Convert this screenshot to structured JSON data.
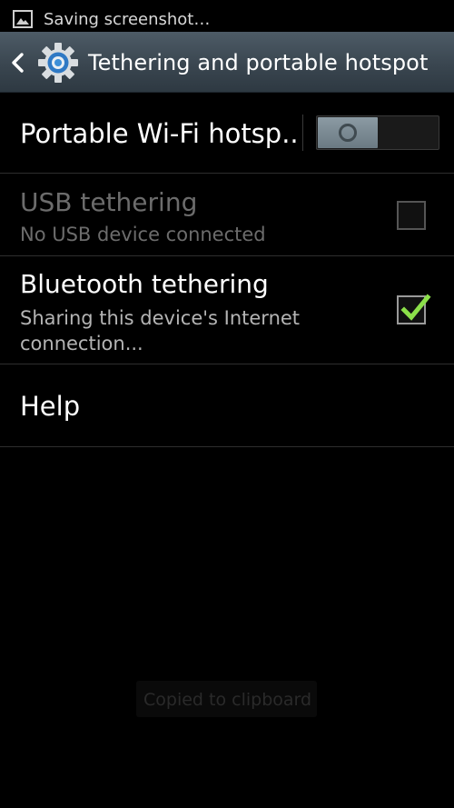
{
  "status_bar": {
    "notification_text": "Saving screenshot…",
    "icons": [
      "image-icon"
    ]
  },
  "action_bar": {
    "title": "Tethering and portable hotspot",
    "icons": [
      "back-arrow-icon",
      "gear-icon"
    ],
    "accent_color": "#3d8fd8"
  },
  "settings": {
    "hotspot": {
      "label": "Portable Wi-Fi hotsp..",
      "enabled": false
    },
    "usb_tethering": {
      "label": "USB tethering",
      "summary": "No USB device connected",
      "enabled": false,
      "checked": false
    },
    "bluetooth_tethering": {
      "label": "Bluetooth tethering",
      "summary": "Sharing this device's Internet connection...",
      "checked": true,
      "check_color": "#8ce04a"
    },
    "help": {
      "label": "Help"
    }
  },
  "toast": {
    "text": "Copied to clipboard"
  }
}
